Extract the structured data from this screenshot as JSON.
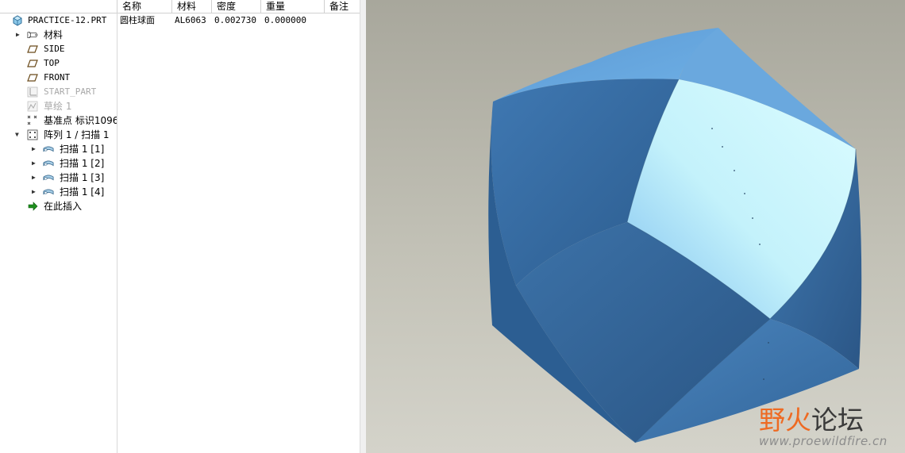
{
  "columns": {
    "name": "名称",
    "material": "材料",
    "density": "密度",
    "weight": "重量",
    "remark": "备注"
  },
  "part_row": {
    "name": "圆柱球面",
    "material": "AL6063",
    "density": "0.002730",
    "weight": "0.000000",
    "remark": ""
  },
  "tree": {
    "root": "PRACTICE-12.PRT",
    "materials": "材料",
    "side": "SIDE",
    "top": "TOP",
    "front": "FRONT",
    "start_part": "START_PART",
    "sketch": "草绘 1",
    "datum_point": "基准点 标识1096",
    "pattern": "阵列 1 / 扫描 1",
    "sweep_1": "扫描 1 [1]",
    "sweep_2": "扫描 1 [2]",
    "sweep_3": "扫描 1 [3]",
    "sweep_4": "扫描 1 [4]",
    "insert_here": "在此插入"
  },
  "watermark": {
    "title_prefix": "野",
    "title_flame": "火",
    "title_suffix": "论坛",
    "url": "www.proewildfire.cn"
  },
  "colors": {
    "model_light": "#d8fbff",
    "model_mid": "#4a86c4",
    "model_dark": "#1f4f7e",
    "watermark_orange": "#ee6a22",
    "background_top": "#a8a79c",
    "background_bottom": "#d4d3ca"
  }
}
